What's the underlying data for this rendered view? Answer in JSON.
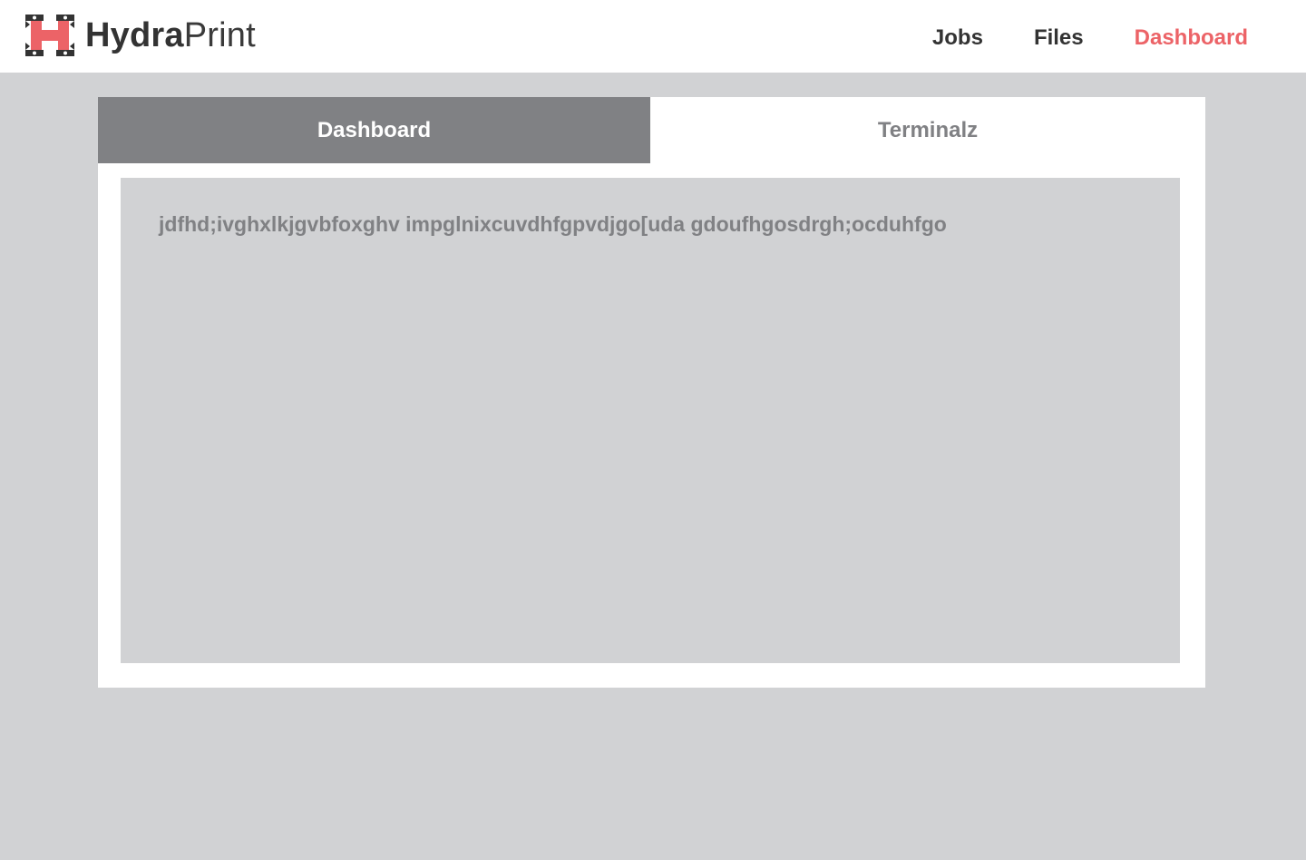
{
  "header": {
    "brand_bold": "Hydra",
    "brand_light": "Print",
    "logo_icon": "hydra-h-logo",
    "nav": [
      {
        "label": "Jobs",
        "active": false
      },
      {
        "label": "Files",
        "active": false
      },
      {
        "label": "Dashboard",
        "active": true
      }
    ]
  },
  "tabs": [
    {
      "label": "Dashboard",
      "active": true
    },
    {
      "label": "Terminalz",
      "active": false
    }
  ],
  "panel": {
    "text": "jdfhd;ivghxlkjgvbfoxghv impglnixcuvdhfgpvdjgo[uda gdoufhgosdrgh;ocduhfgo"
  },
  "colors": {
    "accent": "#ec6367",
    "tab_active_bg": "#808184",
    "background": "#d1d2d4",
    "text_dark": "#333333"
  }
}
